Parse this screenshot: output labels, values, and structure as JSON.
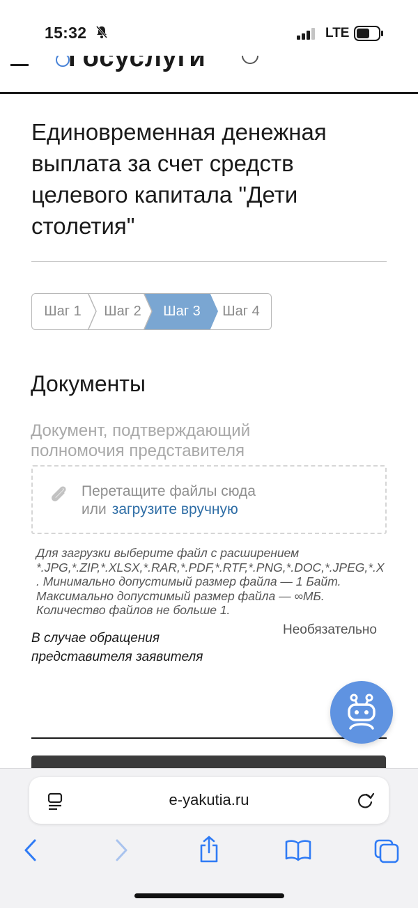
{
  "status_bar": {
    "time": "15:32",
    "network": "LTE"
  },
  "header": {
    "logo_text": "Госуслуги"
  },
  "page": {
    "title": "Единовременная денежная выплата за счет средств целевого капитала \"Дети столетия\""
  },
  "steps": [
    {
      "label": "Шаг 1",
      "active": false
    },
    {
      "label": "Шаг 2",
      "active": false
    },
    {
      "label": "Шаг 3",
      "active": true
    },
    {
      "label": "Шаг 4",
      "active": false
    }
  ],
  "documents": {
    "section_title": "Документы",
    "field_label": "Документ, подтверждающий полномочия представителя",
    "dropzone": {
      "text": "Перетащите файлы сюда",
      "or": "или",
      "upload_link": "загрузите вручную"
    },
    "hint_lines": [
      "Для загрузки выберите файл с расширением",
      "*.JPG,*.ZIP,*.XLSX,*.RAR,*.PDF,*.RTF,*.PNG,*.DOC,*.JPEG,*.X",
      ". Минимально допустимый размер файла — 1 Байт.",
      "Максимально допустимый размер файла — ∞МБ.",
      "Количество файлов не больше 1."
    ],
    "optional_label": "Необязательно",
    "case_text": "В случае обращения представителя заявителя"
  },
  "browser": {
    "url": "e-yakutia.ru"
  },
  "colors": {
    "step_active": "#7aa6d2",
    "link": "#2f6ea6",
    "bot_button": "#5f93e1"
  }
}
